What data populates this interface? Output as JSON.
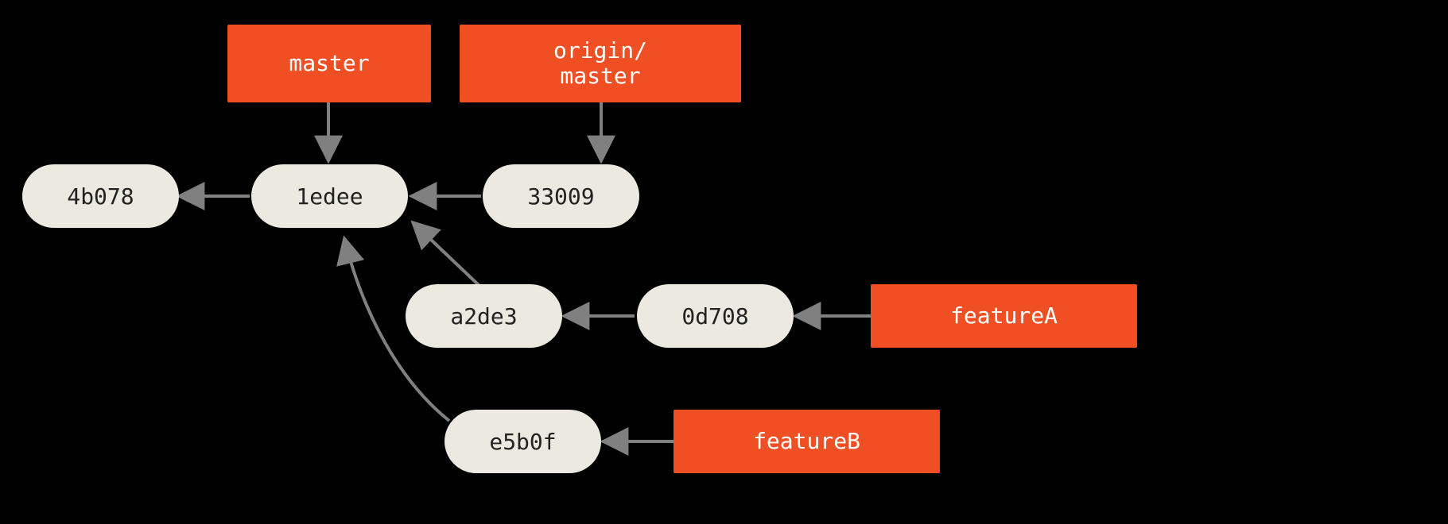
{
  "colors": {
    "branch_bg": "#f04e23",
    "commit_bg": "#eceae0",
    "edge": "#808080",
    "bg": "#000000"
  },
  "branches": {
    "master": {
      "label": "master"
    },
    "origin_master": {
      "label": "origin/\nmaster"
    },
    "featureA": {
      "label": "featureA"
    },
    "featureB": {
      "label": "featureB"
    }
  },
  "commits": {
    "c4b078": {
      "hash": "4b078"
    },
    "c1edee": {
      "hash": "1edee"
    },
    "c33009": {
      "hash": "33009"
    },
    "ca2de3": {
      "hash": "a2de3"
    },
    "c0d708": {
      "hash": "0d708"
    },
    "ce5b0f": {
      "hash": "e5b0f"
    }
  },
  "edges": [
    {
      "from": "master",
      "to": "c1edee",
      "kind": "points"
    },
    {
      "from": "origin_master",
      "to": "c33009",
      "kind": "points"
    },
    {
      "from": "featureA",
      "to": "c0d708",
      "kind": "points"
    },
    {
      "from": "featureB",
      "to": "ce5b0f",
      "kind": "points"
    },
    {
      "from": "c1edee",
      "to": "c4b078",
      "kind": "parent"
    },
    {
      "from": "c33009",
      "to": "c1edee",
      "kind": "parent"
    },
    {
      "from": "ca2de3",
      "to": "c1edee",
      "kind": "parent"
    },
    {
      "from": "c0d708",
      "to": "ca2de3",
      "kind": "parent"
    },
    {
      "from": "ce5b0f",
      "to": "c1edee",
      "kind": "parent"
    }
  ]
}
